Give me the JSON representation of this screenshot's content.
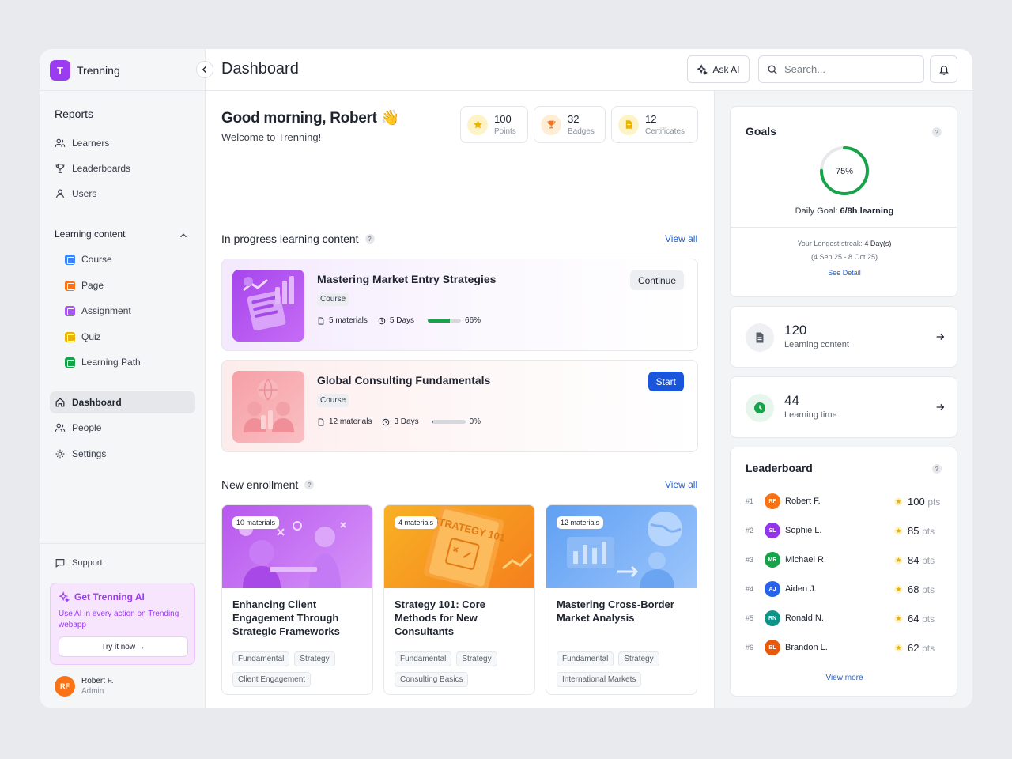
{
  "app": {
    "logo_letter": "T",
    "name": "Trenning",
    "brand_color": "#9b3cf0"
  },
  "sidebar": {
    "reports_title": "Reports",
    "reports": [
      {
        "label": "Learners",
        "icon": "users-icon"
      },
      {
        "label": "Leaderboards",
        "icon": "trophy-icon"
      },
      {
        "label": "Users",
        "icon": "user-icon"
      }
    ],
    "learning_title": "Learning content",
    "learning": [
      {
        "label": "Course",
        "icon": "course-icon",
        "color": "#3b82f6"
      },
      {
        "label": "Page",
        "icon": "page-icon",
        "color": "#f97316"
      },
      {
        "label": "Assignment",
        "icon": "assignment-icon",
        "color": "#a855f7"
      },
      {
        "label": "Quiz",
        "icon": "quiz-icon",
        "color": "#eab308"
      },
      {
        "label": "Learning Path",
        "icon": "learning-path-icon",
        "color": "#16a34a"
      }
    ],
    "main_nav": [
      {
        "label": "Dashboard",
        "icon": "home-icon",
        "active": true
      },
      {
        "label": "People",
        "icon": "people-icon"
      },
      {
        "label": "Settings",
        "icon": "gear-icon"
      }
    ],
    "support": "Support",
    "ai_card": {
      "title": "Get Trenning AI",
      "desc": "Use AI in every action on Trending webapp",
      "button": "Try it now →"
    },
    "user": {
      "initials": "RF",
      "name": "Robert F.",
      "role": "Admin",
      "color": "#f97316"
    }
  },
  "topbar": {
    "title": "Dashboard",
    "ask_ai": "Ask AI",
    "search_placeholder": "Search..."
  },
  "main": {
    "greeting": "Good morning, Robert 👋",
    "welcome": "Welcome to Trenning!",
    "stats": [
      {
        "value": "100",
        "label": "Points",
        "icon": "star-icon",
        "color": "#eab308",
        "bg": "#fef3c7"
      },
      {
        "value": "32",
        "label": "Badges",
        "icon": "trophy-icon",
        "color": "#f97316",
        "bg": "#ffedd5"
      },
      {
        "value": "12",
        "label": "Certificates",
        "icon": "certificate-icon",
        "color": "#eab308",
        "bg": "#fef3c7"
      }
    ],
    "in_progress_title": "In progress learning content",
    "view_all": "View all",
    "in_progress": [
      {
        "title": "Mastering Market Entry Strategies",
        "tag": "Course",
        "materials": "5 materials",
        "days": "5 Days",
        "progress": 66,
        "progress_label": "66%",
        "action": "Continue"
      },
      {
        "title": "Global Consulting Fundamentals",
        "tag": "Course",
        "materials": "12 materials",
        "days": "3 Days",
        "progress": 0,
        "progress_label": "0%",
        "action": "Start"
      }
    ],
    "new_enrollment_title": "New enrollment",
    "enrollments": [
      {
        "materials": "10 materials",
        "title": "Enhancing Client Engagement Through Strategic Frameworks",
        "tags": [
          "Fundamental",
          "Strategy",
          "Client Engagement"
        ]
      },
      {
        "materials": "4 materials",
        "title": "Strategy 101: Core Methods for New Consultants",
        "tags": [
          "Fundamental",
          "Strategy",
          "Consulting Basics"
        ],
        "img_text": "STRATEGY 101"
      },
      {
        "materials": "12 materials",
        "title": "Mastering Cross-Border Market Analysis",
        "tags": [
          "Fundamental",
          "Strategy",
          "International Markets"
        ]
      }
    ]
  },
  "right": {
    "goals": {
      "title": "Goals",
      "percent": 75,
      "percent_label": "75%",
      "daily_prefix": "Daily Goal: ",
      "daily_value": "6/8h learning",
      "streak_prefix": "Your Longest streak: ",
      "streak_value": "4 Day(s)",
      "streak_range": "(4 Sep 25 - 8 Oct 25)",
      "see_detail": "See Detail",
      "ring_color": "#16a34a"
    },
    "kpis": [
      {
        "value": "120",
        "label": "Learning content",
        "icon": "document-icon"
      },
      {
        "value": "44",
        "label": "Learning time",
        "icon": "clock-icon"
      }
    ],
    "leaderboard": {
      "title": "Leaderboard",
      "rows": [
        {
          "rank": "#1",
          "initials": "RF",
          "name": "Robert F.",
          "points": "100",
          "unit": "pts",
          "color": "#f97316"
        },
        {
          "rank": "#2",
          "initials": "SL",
          "name": "Sophie L.",
          "points": "85",
          "unit": "pts",
          "color": "#9333ea"
        },
        {
          "rank": "#3",
          "initials": "MR",
          "name": "Michael R.",
          "points": "84",
          "unit": "pts",
          "color": "#16a34a"
        },
        {
          "rank": "#4",
          "initials": "AJ",
          "name": "Aiden J.",
          "points": "68",
          "unit": "pts",
          "color": "#2563eb"
        },
        {
          "rank": "#5",
          "initials": "RN",
          "name": "Ronald N.",
          "points": "64",
          "unit": "pts",
          "color": "#0d9488"
        },
        {
          "rank": "#6",
          "initials": "BL",
          "name": "Brandon L.",
          "points": "62",
          "unit": "pts",
          "color": "#ea580c"
        }
      ],
      "view_more": "View more"
    }
  }
}
